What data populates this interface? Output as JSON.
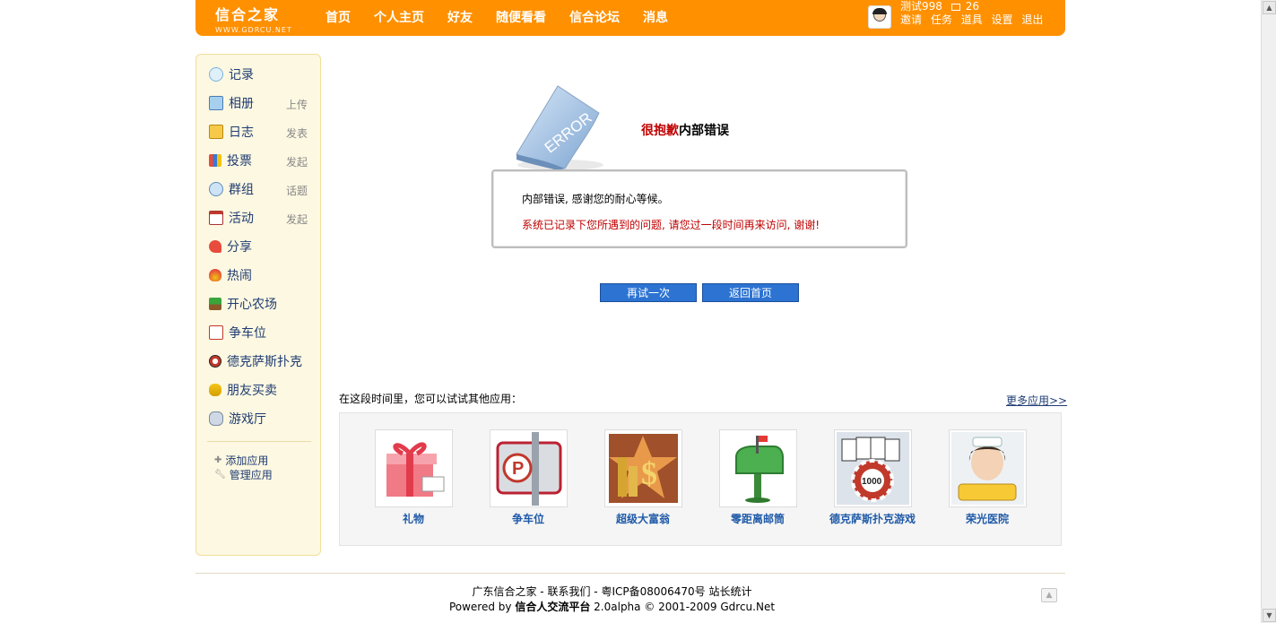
{
  "header": {
    "logo_text": "信合之家",
    "logo_sub": "WWW.GDRCU.NET",
    "nav": [
      "首页",
      "个人主页",
      "好友",
      "随便看看",
      "信合论坛",
      "消息"
    ],
    "username": "测试998",
    "message_count": "26",
    "user_links": [
      "邀请",
      "任务",
      "道具",
      "设置",
      "退出"
    ]
  },
  "sidebar": {
    "apps": [
      {
        "name": "记录",
        "action": ""
      },
      {
        "name": "相册",
        "action": "上传"
      },
      {
        "name": "日志",
        "action": "发表"
      },
      {
        "name": "投票",
        "action": "发起"
      },
      {
        "name": "群组",
        "action": "话题"
      },
      {
        "name": "活动",
        "action": "发起"
      },
      {
        "name": "分享",
        "action": ""
      },
      {
        "name": "热闹",
        "action": ""
      },
      {
        "name": "开心农场",
        "action": ""
      },
      {
        "name": "争车位",
        "action": ""
      },
      {
        "name": "德克萨斯扑克",
        "action": ""
      },
      {
        "name": "朋友买卖",
        "action": ""
      },
      {
        "name": "游戏厅",
        "action": ""
      }
    ],
    "add_app": "添加应用",
    "manage_app": "管理应用"
  },
  "error": {
    "image_text": "ERROR",
    "title_red": "很抱歉",
    "title_black": "内部错误",
    "message": "内部错误, 感谢您的耐心等候。",
    "detail": "系统已记录下您所遇到的问题, 请您过一段时间再来访问, 谢谢!",
    "retry_button": "再试一次",
    "home_button": "返回首页"
  },
  "suggest": {
    "label": "在这段时间里，您可以试试其他应用：",
    "more_link": "更多应用>>",
    "apps": [
      "礼物",
      "争车位",
      "超级大富翁",
      "零距离邮筒",
      "德克萨斯扑克游戏",
      "荣光医院"
    ]
  },
  "footer": {
    "line1": [
      "广东信合之家",
      "联系我们",
      "粤ICP备08006470号",
      "站长统计"
    ],
    "powered_prefix": "Powered by",
    "powered_name": "信合人交流平台",
    "powered_suffix": "2.0alpha © 2001-2009 Gdrcu.Net"
  },
  "colors": {
    "brand_orange": "#ff9000",
    "sidebar_bg": "#fdf8e1",
    "link_blue": "#1f3c73",
    "error_red": "#c00000",
    "button_blue": "#2c73d2"
  }
}
